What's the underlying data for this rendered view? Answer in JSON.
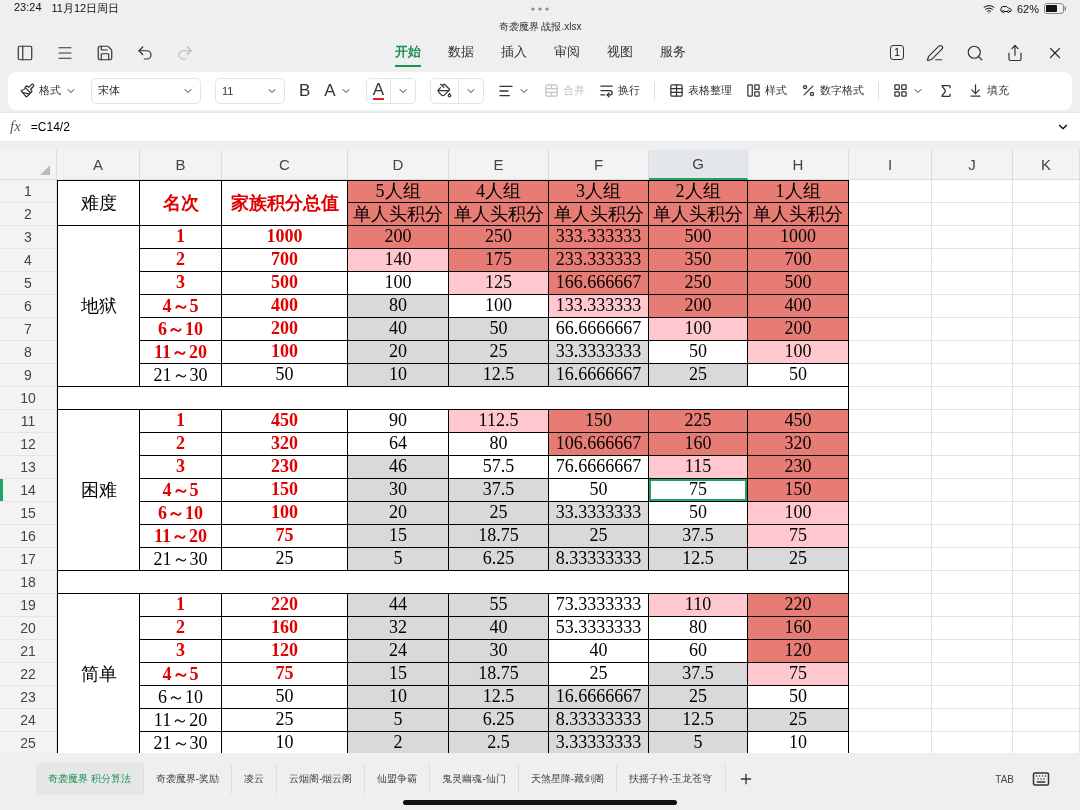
{
  "status_bar": {
    "time": "23:24",
    "date": "11月12日周日",
    "battery": "62%"
  },
  "window": {
    "title": "奇袭魔界 战报.xlsx"
  },
  "menu_tabs": [
    {
      "label": "开始",
      "selected": true
    },
    {
      "label": "数据",
      "selected": false
    },
    {
      "label": "插入",
      "selected": false
    },
    {
      "label": "审阅",
      "selected": false
    },
    {
      "label": "视图",
      "selected": false
    },
    {
      "label": "服务",
      "selected": false
    }
  ],
  "page_count": "1",
  "toolbar": {
    "format": "格式",
    "font": "宋体",
    "font_size": "11",
    "bold": "B",
    "grow_font": "A",
    "font_color": "A",
    "merge": {
      "label": "合并",
      "disabled": true
    },
    "wrap": "换行",
    "table_tidy": "表格整理",
    "style": "样式",
    "number_format": "数字格式",
    "fill": "填充"
  },
  "formula_bar": {
    "fx": "fx",
    "formula": "=C14/2"
  },
  "columns": [
    {
      "label": "A",
      "selected": false
    },
    {
      "label": "B",
      "selected": false
    },
    {
      "label": "C",
      "selected": false
    },
    {
      "label": "D",
      "selected": false
    },
    {
      "label": "E",
      "selected": false
    },
    {
      "label": "F",
      "selected": false
    },
    {
      "label": "G",
      "selected": true
    },
    {
      "label": "H",
      "selected": false
    },
    {
      "label": "I",
      "selected": false
    },
    {
      "label": "J",
      "selected": false
    },
    {
      "label": "K",
      "selected": false
    }
  ],
  "row_numbers": [
    {
      "label": "1",
      "selected": false
    },
    {
      "label": "2",
      "selected": false
    },
    {
      "label": "3",
      "selected": false
    },
    {
      "label": "4",
      "selected": false
    },
    {
      "label": "5",
      "selected": false
    },
    {
      "label": "6",
      "selected": false
    },
    {
      "label": "7",
      "selected": false
    },
    {
      "label": "8",
      "selected": false
    },
    {
      "label": "9",
      "selected": false
    },
    {
      "label": "10",
      "selected": false
    },
    {
      "label": "11",
      "selected": false
    },
    {
      "label": "12",
      "selected": false
    },
    {
      "label": "13",
      "selected": false
    },
    {
      "label": "14",
      "selected": true
    },
    {
      "label": "15",
      "selected": false
    },
    {
      "label": "16",
      "selected": false
    },
    {
      "label": "17",
      "selected": false
    },
    {
      "label": "18",
      "selected": false
    },
    {
      "label": "19",
      "selected": false
    },
    {
      "label": "20",
      "selected": false
    },
    {
      "label": "21",
      "selected": false
    },
    {
      "label": "22",
      "selected": false
    },
    {
      "label": "23",
      "selected": false
    },
    {
      "label": "24",
      "selected": false
    },
    {
      "label": "25",
      "selected": false
    }
  ],
  "table": {
    "headers": [
      "难度",
      "名次",
      "家族积分总值"
    ],
    "groups": [
      {
        "label": "5人组",
        "sub": "单人头积分",
        "color": "#e67c73"
      },
      {
        "label": "4人组",
        "sub": "单人头积分",
        "color": "#e67c73"
      },
      {
        "label": "3人组",
        "sub": "单人头积分",
        "color": "#e67c73"
      },
      {
        "label": "2人组",
        "sub": "单人头积分",
        "color": "#e67c73"
      },
      {
        "label": "1人组",
        "sub": "单人头积分",
        "color": "#e67c73"
      }
    ],
    "sections": [
      {
        "difficulty": "地狱",
        "rows": [
          {
            "rank": "1",
            "total": "1000",
            "highlight": true,
            "values": [
              {
                "text": "200",
                "color": "#e67c73",
                "selected": false
              },
              {
                "text": "250",
                "color": "#e67c73",
                "selected": false
              },
              {
                "text": "333.333333",
                "color": "#e67c73",
                "selected": false
              },
              {
                "text": "500",
                "color": "#e67c73",
                "selected": false
              },
              {
                "text": "1000",
                "color": "#e67c73",
                "selected": false
              }
            ]
          },
          {
            "rank": "2",
            "total": "700",
            "highlight": true,
            "values": [
              {
                "text": "140",
                "color": "#ffc7ce",
                "selected": false
              },
              {
                "text": "175",
                "color": "#e67c73",
                "selected": false
              },
              {
                "text": "233.333333",
                "color": "#e67c73",
                "selected": false
              },
              {
                "text": "350",
                "color": "#e67c73",
                "selected": false
              },
              {
                "text": "700",
                "color": "#e67c73",
                "selected": false
              }
            ]
          },
          {
            "rank": "3",
            "total": "500",
            "highlight": true,
            "values": [
              {
                "text": "100",
                "color": "#ffffff",
                "selected": false
              },
              {
                "text": "125",
                "color": "#ffc7ce",
                "selected": false
              },
              {
                "text": "166.666667",
                "color": "#e67c73",
                "selected": false
              },
              {
                "text": "250",
                "color": "#e67c73",
                "selected": false
              },
              {
                "text": "500",
                "color": "#e67c73",
                "selected": false
              }
            ]
          },
          {
            "rank": "4～5",
            "total": "400",
            "highlight": true,
            "values": [
              {
                "text": "80",
                "color": "#d9d9d9",
                "selected": false
              },
              {
                "text": "100",
                "color": "#ffffff",
                "selected": false
              },
              {
                "text": "133.333333",
                "color": "#ffc7ce",
                "selected": false
              },
              {
                "text": "200",
                "color": "#e67c73",
                "selected": false
              },
              {
                "text": "400",
                "color": "#e67c73",
                "selected": false
              }
            ]
          },
          {
            "rank": "6～10",
            "total": "200",
            "highlight": true,
            "values": [
              {
                "text": "40",
                "color": "#d9d9d9",
                "selected": false
              },
              {
                "text": "50",
                "color": "#d9d9d9",
                "selected": false
              },
              {
                "text": "66.6666667",
                "color": "#ffffff",
                "selected": false
              },
              {
                "text": "100",
                "color": "#ffc7ce",
                "selected": false
              },
              {
                "text": "200",
                "color": "#e67c73",
                "selected": false
              }
            ]
          },
          {
            "rank": "11～20",
            "total": "100",
            "highlight": true,
            "values": [
              {
                "text": "20",
                "color": "#d9d9d9",
                "selected": false
              },
              {
                "text": "25",
                "color": "#d9d9d9",
                "selected": false
              },
              {
                "text": "33.3333333",
                "color": "#d9d9d9",
                "selected": false
              },
              {
                "text": "50",
                "color": "#ffffff",
                "selected": false
              },
              {
                "text": "100",
                "color": "#ffc7ce",
                "selected": false
              }
            ]
          },
          {
            "rank": "21～30",
            "total": "50",
            "highlight": false,
            "values": [
              {
                "text": "10",
                "color": "#d9d9d9",
                "selected": false
              },
              {
                "text": "12.5",
                "color": "#d9d9d9",
                "selected": false
              },
              {
                "text": "16.6666667",
                "color": "#d9d9d9",
                "selected": false
              },
              {
                "text": "25",
                "color": "#d9d9d9",
                "selected": false
              },
              {
                "text": "50",
                "color": "#ffffff",
                "selected": false
              }
            ]
          }
        ]
      },
      {
        "difficulty": "困难",
        "rows": [
          {
            "rank": "1",
            "total": "450",
            "highlight": true,
            "values": [
              {
                "text": "90",
                "color": "#ffffff",
                "selected": false
              },
              {
                "text": "112.5",
                "color": "#ffc7ce",
                "selected": false
              },
              {
                "text": "150",
                "color": "#e67c73",
                "selected": false
              },
              {
                "text": "225",
                "color": "#e67c73",
                "selected": false
              },
              {
                "text": "450",
                "color": "#e67c73",
                "selected": false
              }
            ]
          },
          {
            "rank": "2",
            "total": "320",
            "highlight": true,
            "values": [
              {
                "text": "64",
                "color": "#ffffff",
                "selected": false
              },
              {
                "text": "80",
                "color": "#ffffff",
                "selected": false
              },
              {
                "text": "106.666667",
                "color": "#e67c73",
                "selected": false
              },
              {
                "text": "160",
                "color": "#e67c73",
                "selected": false
              },
              {
                "text": "320",
                "color": "#e67c73",
                "selected": false
              }
            ]
          },
          {
            "rank": "3",
            "total": "230",
            "highlight": true,
            "values": [
              {
                "text": "46",
                "color": "#d9d9d9",
                "selected": false
              },
              {
                "text": "57.5",
                "color": "#ffffff",
                "selected": false
              },
              {
                "text": "76.6666667",
                "color": "#ffffff",
                "selected": false
              },
              {
                "text": "115",
                "color": "#ffc7ce",
                "selected": false
              },
              {
                "text": "230",
                "color": "#e67c73",
                "selected": false
              }
            ]
          },
          {
            "rank": "4～5",
            "total": "150",
            "highlight": true,
            "values": [
              {
                "text": "30",
                "color": "#d9d9d9",
                "selected": false
              },
              {
                "text": "37.5",
                "color": "#d9d9d9",
                "selected": false
              },
              {
                "text": "50",
                "color": "#ffffff",
                "selected": false
              },
              {
                "text": "75",
                "color": "#ffffff",
                "selected": true
              },
              {
                "text": "150",
                "color": "#e67c73",
                "selected": false
              }
            ]
          },
          {
            "rank": "6～10",
            "total": "100",
            "highlight": true,
            "values": [
              {
                "text": "20",
                "color": "#d9d9d9",
                "selected": false
              },
              {
                "text": "25",
                "color": "#d9d9d9",
                "selected": false
              },
              {
                "text": "33.3333333",
                "color": "#d9d9d9",
                "selected": false
              },
              {
                "text": "50",
                "color": "#ffffff",
                "selected": false
              },
              {
                "text": "100",
                "color": "#ffc7ce",
                "selected": false
              }
            ]
          },
          {
            "rank": "11～20",
            "total": "75",
            "highlight": true,
            "values": [
              {
                "text": "15",
                "color": "#d9d9d9",
                "selected": false
              },
              {
                "text": "18.75",
                "color": "#d9d9d9",
                "selected": false
              },
              {
                "text": "25",
                "color": "#d9d9d9",
                "selected": false
              },
              {
                "text": "37.5",
                "color": "#d9d9d9",
                "selected": false
              },
              {
                "text": "75",
                "color": "#ffc7ce",
                "selected": false
              }
            ]
          },
          {
            "rank": "21～30",
            "total": "25",
            "highlight": false,
            "values": [
              {
                "text": "5",
                "color": "#d9d9d9",
                "selected": false
              },
              {
                "text": "6.25",
                "color": "#d9d9d9",
                "selected": false
              },
              {
                "text": "8.33333333",
                "color": "#d9d9d9",
                "selected": false
              },
              {
                "text": "12.5",
                "color": "#d9d9d9",
                "selected": false
              },
              {
                "text": "25",
                "color": "#d9d9d9",
                "selected": false
              }
            ]
          }
        ]
      },
      {
        "difficulty": "简单",
        "rows": [
          {
            "rank": "1",
            "total": "220",
            "highlight": true,
            "values": [
              {
                "text": "44",
                "color": "#d9d9d9",
                "selected": false
              },
              {
                "text": "55",
                "color": "#d9d9d9",
                "selected": false
              },
              {
                "text": "73.3333333",
                "color": "#ffffff",
                "selected": false
              },
              {
                "text": "110",
                "color": "#ffc7ce",
                "selected": false
              },
              {
                "text": "220",
                "color": "#e67c73",
                "selected": false
              }
            ]
          },
          {
            "rank": "2",
            "total": "160",
            "highlight": true,
            "values": [
              {
                "text": "32",
                "color": "#d9d9d9",
                "selected": false
              },
              {
                "text": "40",
                "color": "#d9d9d9",
                "selected": false
              },
              {
                "text": "53.3333333",
                "color": "#ffffff",
                "selected": false
              },
              {
                "text": "80",
                "color": "#ffffff",
                "selected": false
              },
              {
                "text": "160",
                "color": "#e67c73",
                "selected": false
              }
            ]
          },
          {
            "rank": "3",
            "total": "120",
            "highlight": true,
            "values": [
              {
                "text": "24",
                "color": "#d9d9d9",
                "selected": false
              },
              {
                "text": "30",
                "color": "#d9d9d9",
                "selected": false
              },
              {
                "text": "40",
                "color": "#ffffff",
                "selected": false
              },
              {
                "text": "60",
                "color": "#ffffff",
                "selected": false
              },
              {
                "text": "120",
                "color": "#e67c73",
                "selected": false
              }
            ]
          },
          {
            "rank": "4～5",
            "total": "75",
            "highlight": true,
            "values": [
              {
                "text": "15",
                "color": "#d9d9d9",
                "selected": false
              },
              {
                "text": "18.75",
                "color": "#d9d9d9",
                "selected": false
              },
              {
                "text": "25",
                "color": "#ffffff",
                "selected": false
              },
              {
                "text": "37.5",
                "color": "#d9d9d9",
                "selected": false
              },
              {
                "text": "75",
                "color": "#ffc7ce",
                "selected": false
              }
            ]
          },
          {
            "rank": "6～10",
            "total": "50",
            "highlight": false,
            "values": [
              {
                "text": "10",
                "color": "#d9d9d9",
                "selected": false
              },
              {
                "text": "12.5",
                "color": "#d9d9d9",
                "selected": false
              },
              {
                "text": "16.6666667",
                "color": "#d9d9d9",
                "selected": false
              },
              {
                "text": "25",
                "color": "#d9d9d9",
                "selected": false
              },
              {
                "text": "50",
                "color": "#ffffff",
                "selected": false
              }
            ]
          },
          {
            "rank": "11～20",
            "total": "25",
            "highlight": false,
            "values": [
              {
                "text": "5",
                "color": "#d9d9d9",
                "selected": false
              },
              {
                "text": "6.25",
                "color": "#d9d9d9",
                "selected": false
              },
              {
                "text": "8.33333333",
                "color": "#d9d9d9",
                "selected": false
              },
              {
                "text": "12.5",
                "color": "#d9d9d9",
                "selected": false
              },
              {
                "text": "25",
                "color": "#d9d9d9",
                "selected": false
              }
            ]
          },
          {
            "rank": "21～30",
            "total": "10",
            "highlight": false,
            "values": [
              {
                "text": "2",
                "color": "#d9d9d9",
                "selected": false
              },
              {
                "text": "2.5",
                "color": "#d9d9d9",
                "selected": false
              },
              {
                "text": "3.33333333",
                "color": "#d9d9d9",
                "selected": false
              },
              {
                "text": "5",
                "color": "#d9d9d9",
                "selected": false
              },
              {
                "text": "10",
                "color": "#ffffff",
                "selected": false
              }
            ]
          }
        ]
      }
    ]
  },
  "sheet_tabs": [
    {
      "label": "奇袭魔界 积分算法",
      "selected": true
    },
    {
      "label": "奇袭魔界-奖励",
      "selected": false
    },
    {
      "label": "凌云",
      "selected": false
    },
    {
      "label": "云烟阁-烟云阁",
      "selected": false
    },
    {
      "label": "仙盟争霸",
      "selected": false
    },
    {
      "label": "鬼灵幽魂-仙门",
      "selected": false
    },
    {
      "label": "天煞星降-藏剑阁",
      "selected": false
    },
    {
      "label": "扶摇子衿-玉龙苍穹",
      "selected": false
    }
  ],
  "tab_key": "TAB"
}
